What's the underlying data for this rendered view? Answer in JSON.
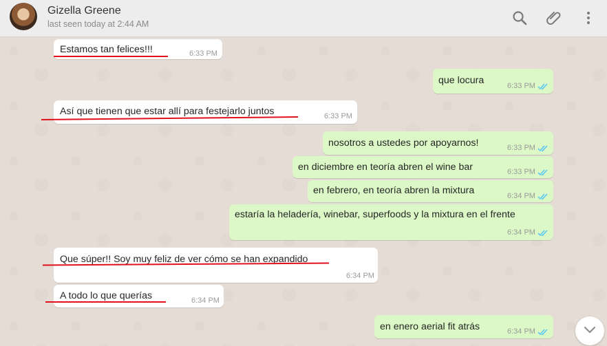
{
  "header": {
    "contact_name": "Gizella Greene",
    "last_seen": "last seen today at 2:44 AM",
    "icons": [
      "search-icon",
      "attach-icon",
      "menu-icon"
    ]
  },
  "colors": {
    "incoming_bubble": "#ffffff",
    "outgoing_bubble": "#dcf8c6",
    "read_ticks": "#4fc3f7",
    "annotation_underline": "#e0101c"
  },
  "messages": [
    {
      "dir": "in",
      "text": "Estamos tan felices!!!",
      "time": "6:33 PM"
    },
    {
      "dir": "out",
      "text": "que locura",
      "time": "6:33 PM"
    },
    {
      "dir": "in",
      "text": "Así que tienen que estar allí para festejarlo juntos",
      "time": "6:33 PM"
    },
    {
      "dir": "out",
      "text": "nosotros a ustedes por apoyarnos!",
      "time": "6:33 PM"
    },
    {
      "dir": "out",
      "text": "en diciembre en teoría abren el wine bar",
      "time": "6:33 PM"
    },
    {
      "dir": "out",
      "text": "en febrero, en teoría abren la mixtura",
      "time": "6:34 PM"
    },
    {
      "dir": "out",
      "text": "estaría la heladería, winebar, superfoods y la mixtura en el frente",
      "time": "6:34 PM"
    },
    {
      "dir": "in",
      "text": "Que súper!! Soy muy feliz de ver cómo se han expandido",
      "time": "6:34 PM"
    },
    {
      "dir": "in",
      "text": "A todo lo que querías",
      "time": "6:34 PM"
    },
    {
      "dir": "out",
      "text": "en enero aerial fit atrás",
      "time": "6:34 PM"
    }
  ]
}
